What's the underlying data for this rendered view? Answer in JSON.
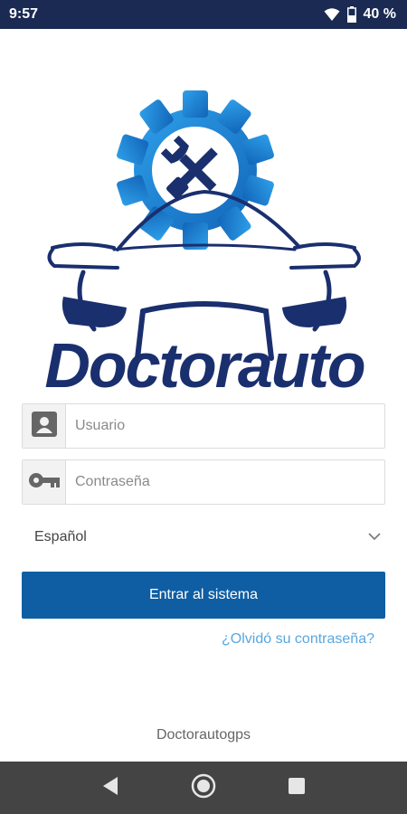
{
  "status_bar": {
    "time": "9:57",
    "battery_percent": "40 %",
    "icons": [
      "wifi-icon",
      "battery-icon"
    ]
  },
  "logo": {
    "brand": "Doctorauto",
    "colors": {
      "gear": "#1e88d8",
      "car": "#1a2f6e"
    }
  },
  "login": {
    "username_placeholder": "Usuario",
    "password_placeholder": "Contraseña",
    "language_selected": "Español",
    "submit_label": "Entrar al sistema",
    "forgot_link": "¿Olvidó su contraseña?"
  },
  "footer": {
    "text": "Doctorautogps"
  },
  "nav_bar": {
    "icons": [
      "back-icon",
      "home-icon",
      "recents-icon"
    ]
  },
  "colors": {
    "status_bar": "#1a2a52",
    "primary_button": "#0f5ea4",
    "link": "#59a7df",
    "nav_bar": "#444444"
  }
}
